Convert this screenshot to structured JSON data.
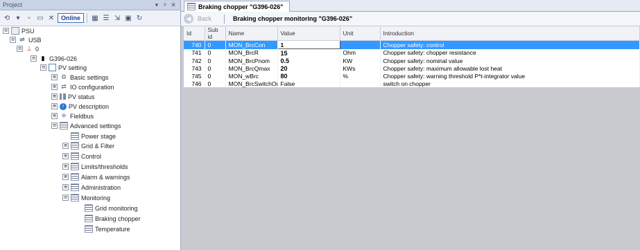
{
  "left_pane": {
    "title": "Project",
    "header_buttons": [
      "▾",
      "ᵖ",
      "✕"
    ],
    "online_label": "Online"
  },
  "tree": [
    {
      "label": "PSU",
      "icon": "folder",
      "expander": "⊟"
    },
    {
      "label": "USB",
      "icon": "usb",
      "expander": "⊟"
    },
    {
      "label": "0",
      "icon": "net",
      "expander": "⊟"
    },
    {
      "label": "G396-026",
      "icon": "device",
      "expander": "⊟"
    },
    {
      "label": "PV setting",
      "icon": "pv",
      "expander": "⊟"
    },
    {
      "label": "Basic settings",
      "icon": "gear",
      "expander": "⊞"
    },
    {
      "label": "IO configuration",
      "icon": "gear",
      "expander": "⊞"
    },
    {
      "label": "PV status",
      "icon": "status",
      "expander": "⊞"
    },
    {
      "label": "PV description",
      "icon": "info",
      "expander": "⊞"
    },
    {
      "label": "Fieldbus",
      "icon": "gear",
      "expander": "⊞"
    },
    {
      "label": "Advanced settings",
      "icon": "list",
      "expander": "⊟"
    },
    {
      "label": "Power stage",
      "icon": "list",
      "expander": ""
    },
    {
      "label": "Grid & Filter",
      "icon": "list",
      "expander": "⊞"
    },
    {
      "label": "Control",
      "icon": "list",
      "expander": "⊞"
    },
    {
      "label": "Limits/thresholds",
      "icon": "list",
      "expander": "⊞"
    },
    {
      "label": "Alarm & warnings",
      "icon": "list",
      "expander": "⊞"
    },
    {
      "label": "Administration",
      "icon": "list",
      "expander": "⊞"
    },
    {
      "label": "Monitoring",
      "icon": "list",
      "expander": "⊟"
    },
    {
      "label": "Grid monitoring",
      "icon": "list",
      "expander": ""
    },
    {
      "label": "Braking chopper",
      "icon": "list",
      "expander": ""
    },
    {
      "label": "Temperature",
      "icon": "list",
      "expander": ""
    }
  ],
  "document": {
    "tab_label": "Braking chopper \"G396-026\"",
    "back_label": "Back",
    "nav_title": "Braking chopper monitoring \"G396-026\""
  },
  "table": {
    "headers": [
      "Id",
      "Sub id",
      "Name",
      "Value",
      "Unit",
      "Introduction"
    ],
    "rows": [
      {
        "id": "740",
        "sub": "0",
        "name": "MON_BrcCon",
        "value": "1",
        "unit": "",
        "intro": "Chopper safety: control",
        "selected": true
      },
      {
        "id": "741",
        "sub": "0",
        "name": "MON_BrcR",
        "value": "15",
        "unit": "Ohm",
        "intro": "Chopper safety: chopper resistance",
        "selected": false
      },
      {
        "id": "742",
        "sub": "0",
        "name": "MON_BrcPnom",
        "value": "0.5",
        "unit": "KW",
        "intro": "Chopper safety: nominal value",
        "selected": false
      },
      {
        "id": "743",
        "sub": "0",
        "name": "MON_BrcQmax",
        "value": "20",
        "unit": "KWs",
        "intro": "Chopper safety: maximum allowable lost heat",
        "selected": false
      },
      {
        "id": "745",
        "sub": "0",
        "name": "MON_wBrc",
        "value": "80",
        "unit": "%",
        "intro": "Chopper safety: warning threshold P*t-integrator value",
        "selected": false
      },
      {
        "id": "746",
        "sub": "0",
        "name": "MON_BrcSwitchOn",
        "value": "False",
        "unit": "",
        "intro": "switch on chopper",
        "selected": false
      }
    ]
  }
}
